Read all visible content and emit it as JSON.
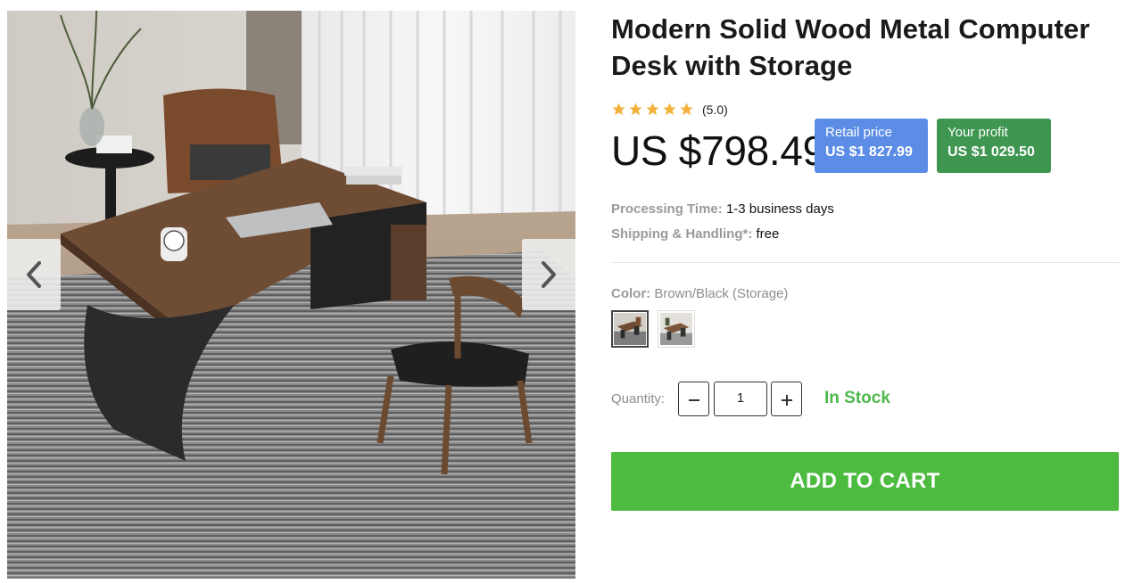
{
  "product": {
    "title": "Modern Solid Wood Metal Computer Desk with Storage",
    "rating_value": 5.0,
    "rating_text": "(5.0)",
    "price": "US $798.49",
    "retail": {
      "label": "Retail price",
      "value": "US $1 827.99"
    },
    "profit": {
      "label": "Your profit",
      "value": "US $1 029.50"
    }
  },
  "details": {
    "processing_label": "Processing Time:",
    "processing_value": "1-3 business days",
    "shipping_label": "Shipping & Handling*:",
    "shipping_value": "free"
  },
  "color": {
    "label": "Color:",
    "value": "Brown/Black (Storage)",
    "swatch_count": 2,
    "selected_index": 0
  },
  "quantity": {
    "label": "Quantity:",
    "value": "1",
    "minus_symbol": "−",
    "plus_symbol": "+"
  },
  "stock_status": "In Stock",
  "cart_button": "ADD TO CART",
  "gallery": {
    "prev_icon": "chevron-left-icon",
    "next_icon": "chevron-right-icon"
  },
  "colors": {
    "retail_badge": "#5b8de6",
    "profit_badge": "#3f9651",
    "in_stock": "#4cb84a",
    "cart_button": "#4cbb3f",
    "star": "#f2b23b"
  }
}
